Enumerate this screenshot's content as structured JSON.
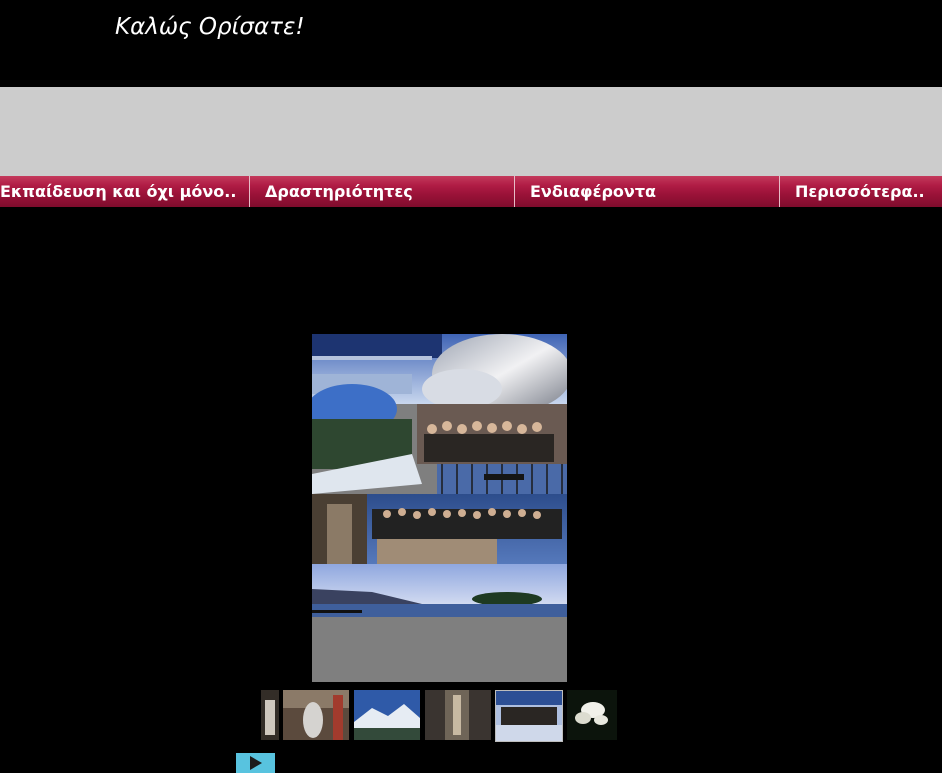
{
  "header": {
    "title": "Καλώς Ορίσατε!"
  },
  "nav": {
    "items": [
      {
        "label": "Εκπαίδευση και όχι μόνο.."
      },
      {
        "label": "Δραστηριότητες"
      },
      {
        "label": "Ενδιαφέροντα"
      },
      {
        "label": "Περισσότερα.."
      }
    ]
  },
  "gallery": {
    "thumbnails_count": 6,
    "selected_index": 4
  },
  "colors": {
    "background": "#000000",
    "banner": "#cccccc",
    "nav": "#9a1238",
    "play_button": "#58c3df"
  }
}
